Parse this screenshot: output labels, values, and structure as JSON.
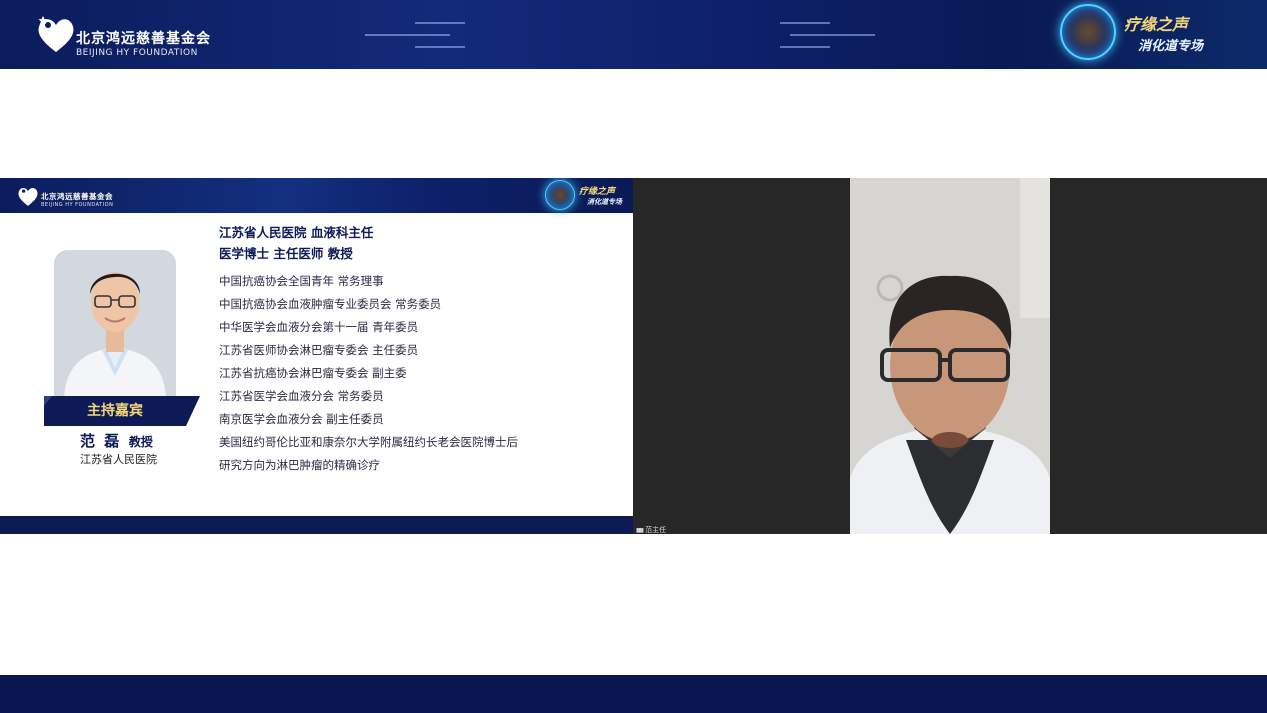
{
  "banner": {
    "logo_cn": "北京鸿远慈善基金会",
    "logo_en": "BEIJING HY FOUNDATION",
    "badge_title": "疗缘之声",
    "badge_subtitle": "消化道专场"
  },
  "slide": {
    "logo_cn": "北京鸿远慈善基金会",
    "logo_en": "BEIJING HY FOUNDATION",
    "badge_title": "疗缘之声",
    "badge_subtitle": "消化道专场",
    "host_label": "主持嘉宾",
    "host_name": "范 磊",
    "host_title": "教授",
    "host_institution": "江苏省人民医院",
    "headline_1": "江苏省人民医院 血液科主任",
    "headline_2": "医学博士 主任医师 教授",
    "bio": [
      "中国抗癌协会全国青年 常务理事",
      "中国抗癌协会血液肿瘤专业委员会 常务委员",
      "中华医学会血液分会第十一届 青年委员",
      "江苏省医师协会淋巴瘤专委会 主任委员",
      "江苏省抗癌协会淋巴瘤专委会 副主委",
      "江苏省医学会血液分会 常务委员",
      "南京医学会血液分会 副主任委员",
      "美国纽约哥伦比亚和康奈尔大学附属纽约长老会医院博士后",
      "研究方向为淋巴肿瘤的精确诊疗"
    ]
  },
  "video": {
    "tile_label": "范主任"
  },
  "colors": {
    "navy": "#0d1a55",
    "accent_gold": "#f5d77a",
    "glow_cyan": "#4fd3ff"
  }
}
